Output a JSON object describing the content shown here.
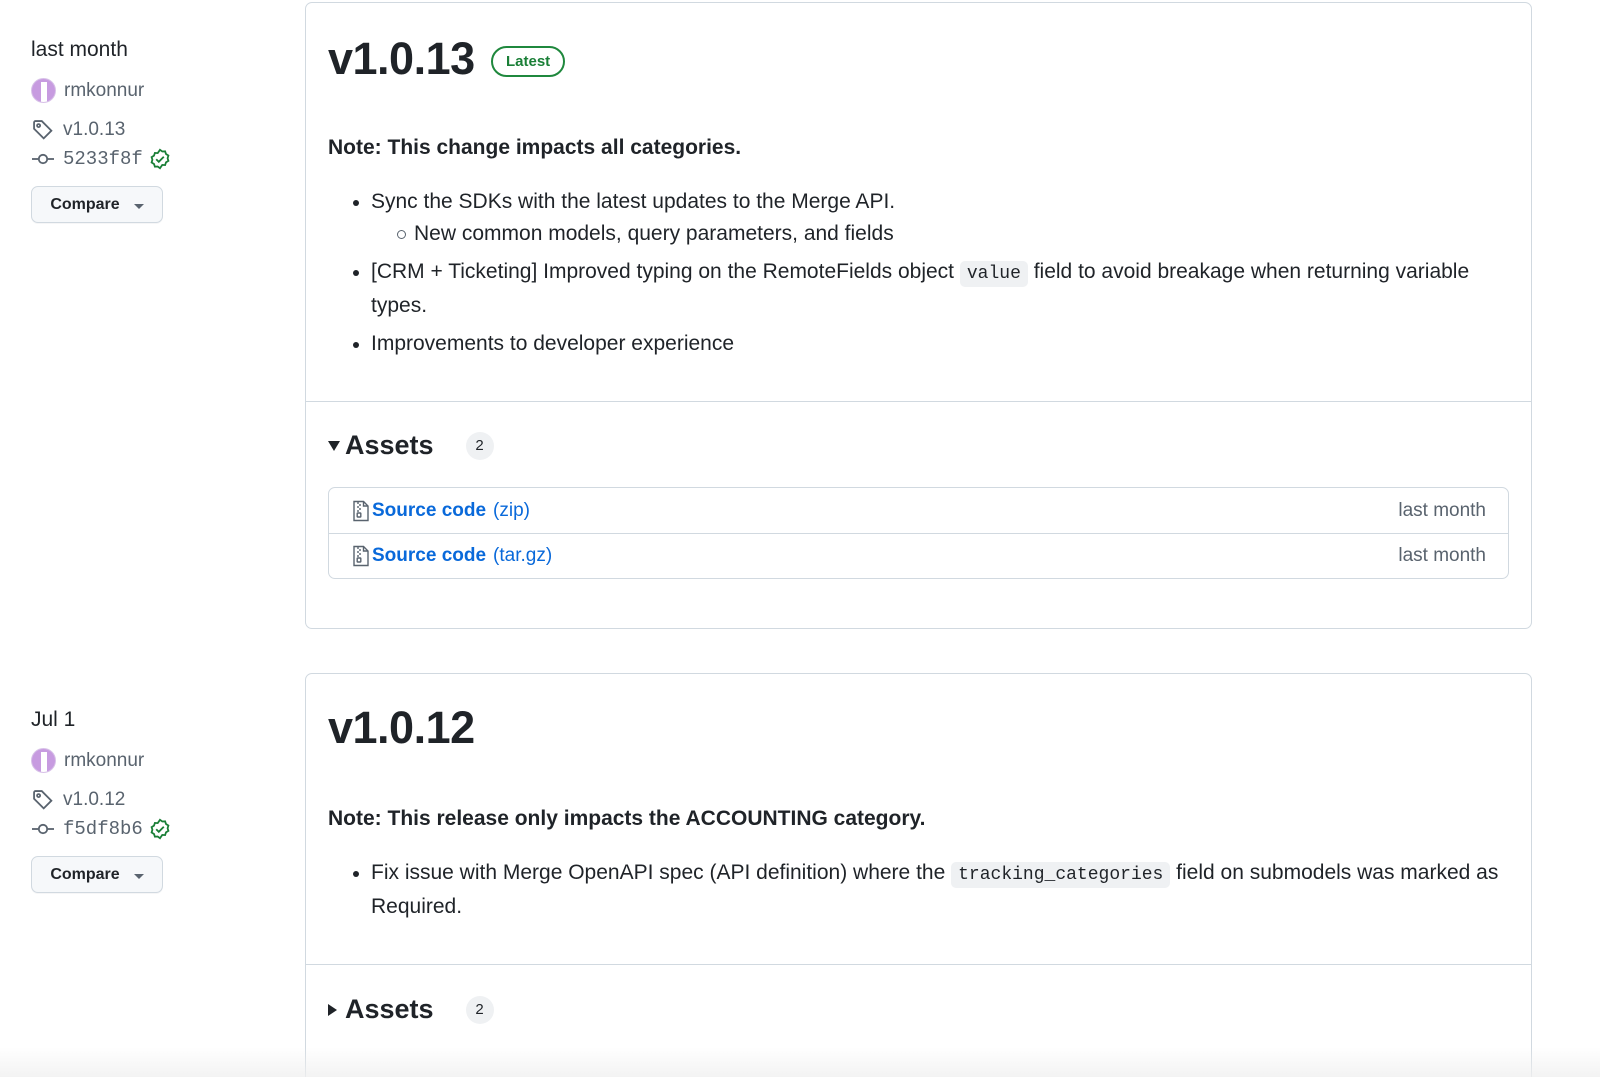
{
  "releases": [
    {
      "date": "last month",
      "author": "rmkonnur",
      "tag": "v1.0.13",
      "commit": "5233f8f",
      "compare_label": "Compare",
      "version": "v1.0.13",
      "latest_badge": "Latest",
      "note": "Note: This change impacts all categories.",
      "bullets": {
        "b1": "Sync the SDKs with the latest updates to the Merge API.",
        "b1_sub": "New common models, query parameters, and fields",
        "b2_pre": "[CRM + Ticketing] Improved typing on the RemoteFields object ",
        "b2_code": "value",
        "b2_post": " field to avoid breakage when returning variable types.",
        "b3": "Improvements to developer experience"
      },
      "assets": {
        "title": "Assets",
        "count": "2",
        "expanded": true,
        "items": [
          {
            "name": "Source code",
            "ext": "(zip)",
            "when": "last month"
          },
          {
            "name": "Source code",
            "ext": "(tar.gz)",
            "when": "last month"
          }
        ]
      }
    },
    {
      "date": "Jul 1",
      "author": "rmkonnur",
      "tag": "v1.0.12",
      "commit": "f5df8b6",
      "compare_label": "Compare",
      "version": "v1.0.12",
      "note": "Note: This release only impacts the ACCOUNTING category.",
      "bullets": {
        "b1_pre": "Fix issue with Merge OpenAPI spec (API definition) where the ",
        "b1_code": "tracking_categories",
        "b1_post": " field on submodels was marked as Required."
      },
      "assets": {
        "title": "Assets",
        "count": "2",
        "expanded": false
      }
    }
  ],
  "colors": {
    "link": "#0969da",
    "latest_badge": "#1a7f37",
    "verified": "#1a7f37",
    "border": "#d1d9e0"
  },
  "icons": [
    "tag-icon",
    "commit-icon",
    "verified-check-icon",
    "file-zip-icon",
    "triangle-down-icon",
    "triangle-right-icon",
    "caret-down-icon"
  ]
}
